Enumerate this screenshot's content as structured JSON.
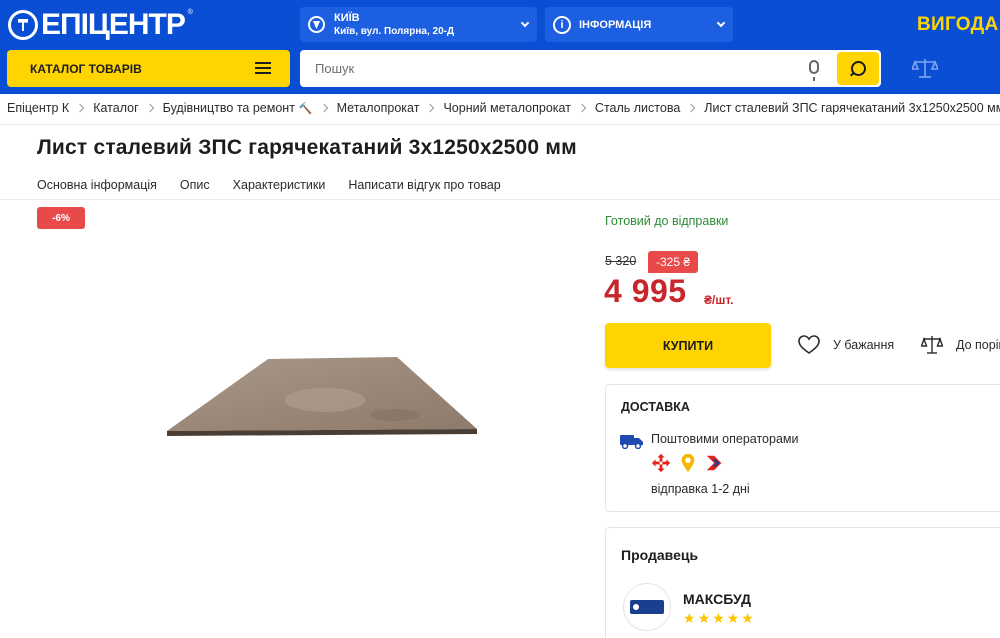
{
  "header": {
    "logo_text": "ЕПІЦЕНТР",
    "logo_reg": "®",
    "location": {
      "city": "КИЇВ",
      "address": "Київ, вул. Полярна, 20-Д"
    },
    "info_label": "ІНФОРМАЦІЯ",
    "vyhoda_label": "ВИГОДА!",
    "catalog_label": "КАТАЛОГ ТОВАРІВ",
    "search_placeholder": "Пошук",
    "colors": {
      "primary": "#0a4ed3",
      "accent": "#ffd400"
    }
  },
  "breadcrumbs": [
    "Епіцентр К",
    "Каталог",
    "Будівництво та ремонт",
    "Металопрокат",
    "Чорний металопрокат",
    "Сталь листова",
    "Лист сталевий ЗПС гарячекатаний 3х1250х2500 мм"
  ],
  "product": {
    "title": "Лист сталевий ЗПС гарячекатаний 3х1250х2500 мм",
    "tabs": [
      "Основна інформація",
      "Опис",
      "Характеристики",
      "Написати відгук про товар"
    ],
    "discount_badge": "-6%",
    "availability": "Готовий до відправки",
    "old_price": "5 320",
    "price_discount": "-325 ₴",
    "new_price": "4 995",
    "unit": "₴/шт.",
    "buy_label": "КУПИТИ",
    "wishlist_label": "У бажання",
    "compare_label": "До порівняння",
    "colors": {
      "price": "#c8262b",
      "ready": "#2e8b36",
      "badge": "#e84a4a"
    }
  },
  "delivery": {
    "title": "ДОСТАВКА",
    "method": "Поштовими операторами",
    "carriers": [
      "nova-poshta-icon",
      "meest-icon",
      "ukrposhta-icon"
    ],
    "ship_time": "відправка 1-2 дні"
  },
  "seller": {
    "title": "Продавець",
    "name": "МАКСБУД",
    "rating_stars": 5
  }
}
